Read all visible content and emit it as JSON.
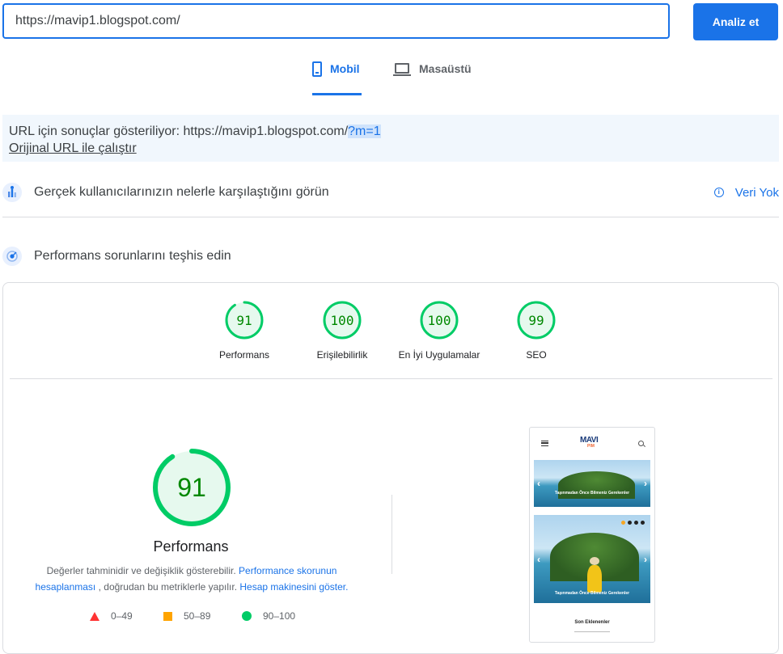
{
  "search": {
    "value": "https://mavip1.blogspot.com/",
    "button_label": "Analiz et"
  },
  "tabs": [
    {
      "label": "Mobil",
      "icon": "phone-icon",
      "active": true
    },
    {
      "label": "Masaüstü",
      "icon": "laptop-icon",
      "active": false
    }
  ],
  "notice": {
    "prefix": "URL için sonuçlar gösteriliyor: https://mavip1.blogspot.com/",
    "highlight": "?m=1",
    "link": "Orijinal URL ile çalıştır"
  },
  "crux": {
    "title": "Gerçek kullanıcılarınızın nelerle karşılaştığını görün",
    "status": "Veri Yok"
  },
  "diagnose": {
    "title": "Performans sorunlarını teşhis edin"
  },
  "scores": [
    {
      "label": "Performans",
      "value": "91",
      "score": 91
    },
    {
      "label": "Erişilebilirlik",
      "value": "100",
      "score": 100
    },
    {
      "label": "En İyi Uygulamalar",
      "value": "100",
      "score": 100
    },
    {
      "label": "SEO",
      "value": "99",
      "score": 99
    }
  ],
  "performance": {
    "score": "91",
    "score_fraction": 0.91,
    "label": "Performans",
    "desc_1": "Değerler tahminidir ve değişiklik gösterebilir.",
    "desc_link_1": "Performance skorunun hesaplanması",
    "desc_2": ", doğrudan bu metriklerle yapılır.",
    "desc_link_2": "Hesap makinesini göster."
  },
  "legend": [
    {
      "range": "0–49",
      "color": "#ff3333",
      "shape": "triangle"
    },
    {
      "range": "50–89",
      "color": "#ffa400",
      "shape": "square"
    },
    {
      "range": "90–100",
      "color": "#00cc66",
      "shape": "circle"
    }
  ],
  "screenshot": {
    "logo": "MAVI",
    "logo_sub": "PIM",
    "slide1_caption": "Taşınmadan Önce Bilmeniz Gerekenler",
    "slide2_caption": "Taşınmadan Önce Bilmeniz Gerekenler",
    "section_title": "Son Eklenenler"
  }
}
